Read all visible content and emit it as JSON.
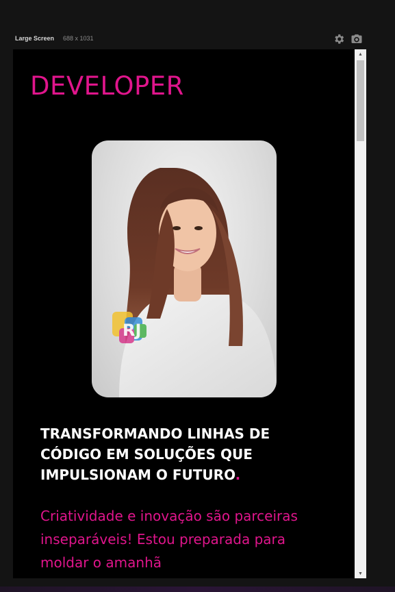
{
  "toolbar": {
    "screen_name": "Large Screen",
    "screen_size": "688 x 1031",
    "icons": [
      "gear-icon",
      "camera-icon"
    ]
  },
  "hero": {
    "title": "DEVELOPER",
    "headline": "TRANSFORMANDO LINHAS DE CÓDIGO EM SOLUÇÕES QUE IMPULSIONAM O FUTURO",
    "headline_punctuation": ".",
    "tagline": "Criatividade e inovação são parceiras inseparáveis! Estou preparada para moldar o amanhã"
  },
  "colors": {
    "accent": "#e0158c",
    "background": "#000000",
    "chrome": "#141414",
    "text": "#ffffff"
  }
}
